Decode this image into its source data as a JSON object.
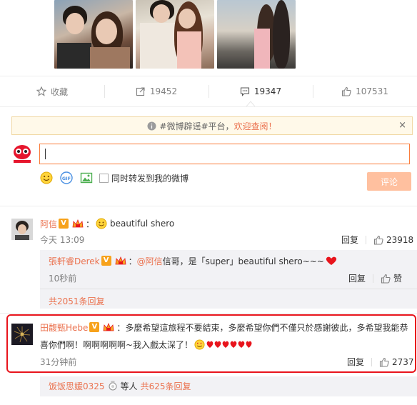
{
  "actions": {
    "favorite": "收藏",
    "repost": "19452",
    "comment": "19347",
    "like": "107531"
  },
  "notice": {
    "prefix": "#微博辟谣#平台，",
    "link": "欢迎查阅！",
    "close": "×"
  },
  "composer": {
    "repost_label": "同时转发到我的微博",
    "submit_label": "评论"
  },
  "comments": [
    {
      "user": "阿信",
      "text": "beautiful shero",
      "time": "今天 13:09",
      "reply": "回复",
      "likes": "23918",
      "sub": {
        "user": "張軒睿Derek",
        "sep": "：",
        "mention": "@阿信",
        "text": " 信哥，是「super」beautiful shero~~~",
        "time": "10秒前",
        "reply": "回复",
        "like": "赞"
      },
      "more": "共2051条回复"
    },
    {
      "user": "田馥甄Hebe",
      "sep": "：",
      "text_line1": "多麼希望這旅程不要結束，多麼希望你們不僅只於感謝彼此，多希望我能恭",
      "text_line2": "喜你們啊！啊啊啊啊啊~我入戲太深了！",
      "time": "31分钟前",
      "reply": "回复",
      "likes": "2737",
      "reply_user": "饭饭思媛0325",
      "reply_others": "等人",
      "more": "共625条回复"
    }
  ],
  "colors": {
    "accent": "#eb7350",
    "highlight": "#e8141c"
  }
}
